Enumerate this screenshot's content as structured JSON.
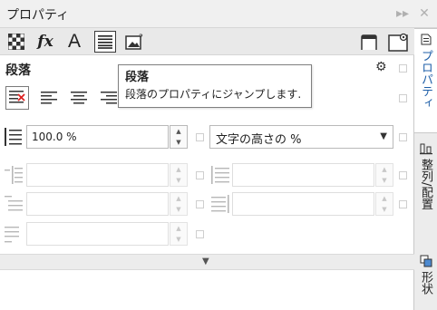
{
  "window": {
    "title": "プロパティ"
  },
  "section": {
    "title": "段落"
  },
  "tooltip": {
    "title": "段落",
    "description": "段落のプロパティにジャンプします."
  },
  "paragraph": {
    "line_spacing_value": "100.0 %",
    "line_spacing_unit": "文字の高さの %"
  },
  "sidebar": {
    "tabs": [
      {
        "label": "プロパティ",
        "active": true
      },
      {
        "label": "整列/配置",
        "active": false
      },
      {
        "label": "形状",
        "active": false
      }
    ]
  },
  "colors": {
    "accent": "#1f5fa8",
    "toolbar": "#e9e9e9",
    "panel": "#ffffff"
  }
}
